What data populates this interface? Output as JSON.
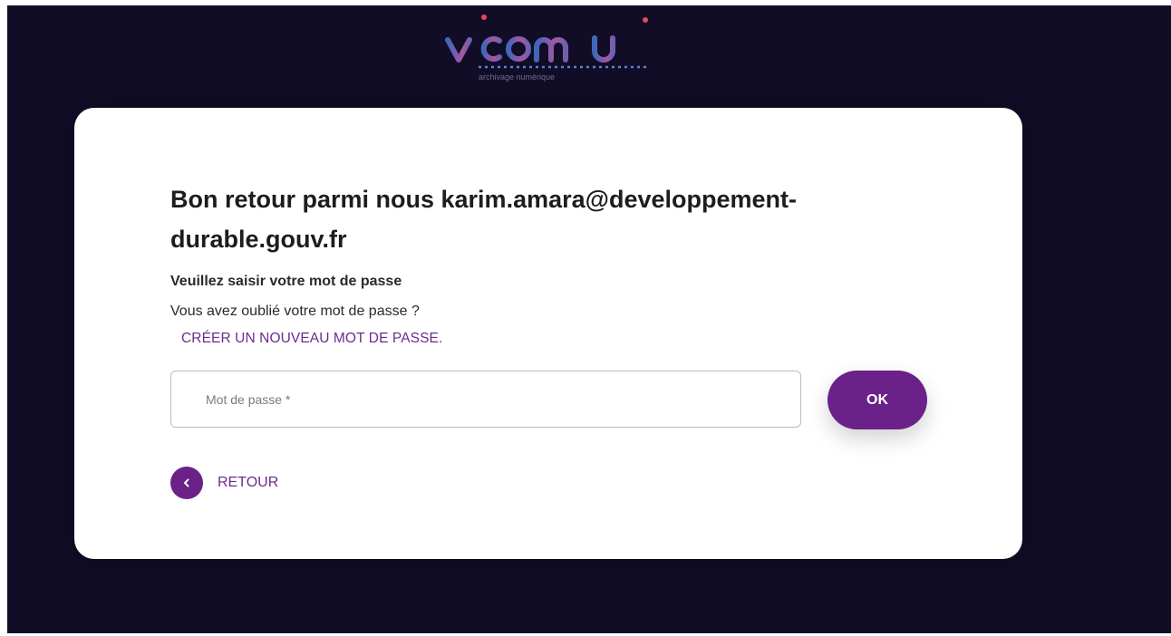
{
  "header": {
    "logo_name": "vitam ui",
    "logo_tagline": "archivage numérique"
  },
  "login": {
    "title": "Bon retour parmi nous karim.amara@developpement-durable.gouv.fr",
    "instruction": "Veuillez saisir votre mot de passe",
    "forgot_text": "Vous avez oublié votre mot de passe ?",
    "create_link": "CRÉER UN NOUVEAU MOT DE PASSE.",
    "password_value": "",
    "password_placeholder": "Mot de passe *",
    "ok_label": "OK",
    "back_label": "RETOUR",
    "back_icon": "chevron-left-icon"
  },
  "colors": {
    "background": "#110d27",
    "card": "#ffffff",
    "accent": "#6a2188",
    "link": "#6a2c8e",
    "text": "#1d1d1f"
  }
}
